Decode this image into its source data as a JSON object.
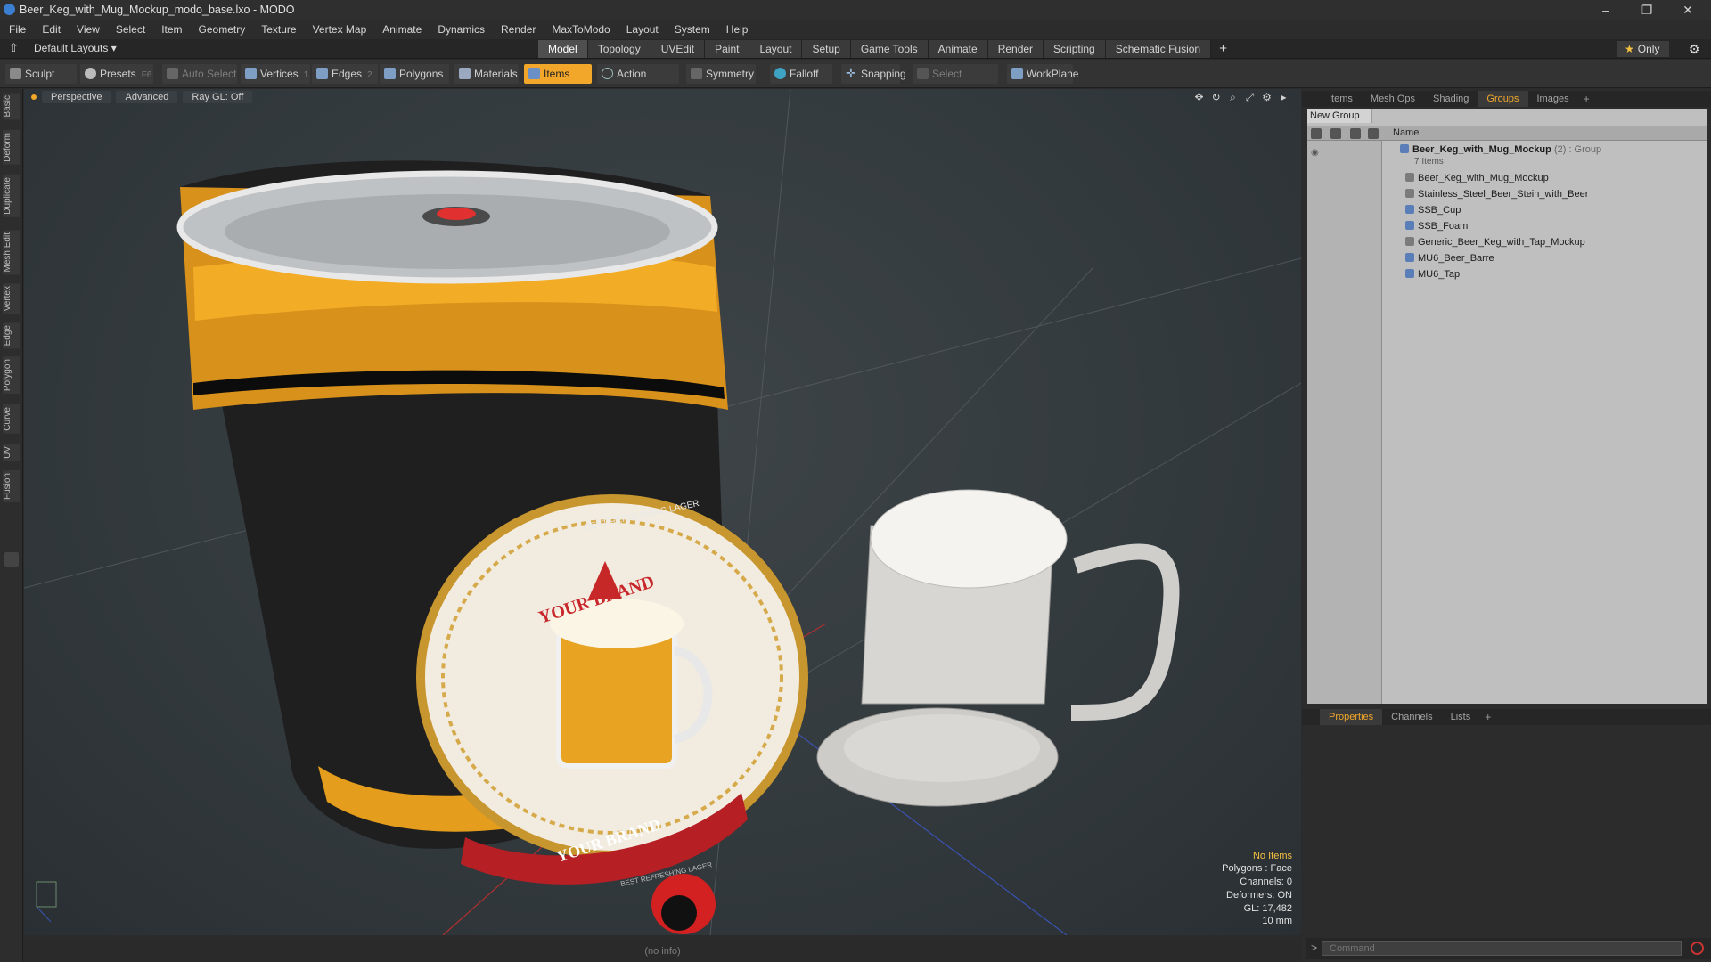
{
  "window": {
    "title": "Beer_Keg_with_Mug_Mockup_modo_base.lxo - MODO",
    "minimize": "–",
    "restore": "❐",
    "close": "✕"
  },
  "menu": [
    "File",
    "Edit",
    "View",
    "Select",
    "Item",
    "Geometry",
    "Texture",
    "Vertex Map",
    "Animate",
    "Dynamics",
    "Render",
    "MaxToModo",
    "Layout",
    "System",
    "Help"
  ],
  "layout": {
    "selector": "Default Layouts ▾",
    "tabs": [
      "Model",
      "Topology",
      "UVEdit",
      "Paint",
      "Layout",
      "Setup",
      "Game Tools",
      "Animate",
      "Render",
      "Scripting",
      "Schematic Fusion"
    ],
    "active_tab": "Model",
    "add": "+",
    "only": "Only"
  },
  "toolbar": {
    "sculpt": "Sculpt",
    "presets": "Presets",
    "presets_key": "F6",
    "auto_select": "Auto Select",
    "vertices": "Vertices",
    "vertices_key": "1",
    "edges": "Edges",
    "edges_key": "2",
    "polygons": "Polygons",
    "materials": "Materials",
    "items": "Items",
    "action_center": "Action Center",
    "symmetry": "Symmetry",
    "falloff": "Falloff",
    "snapping": "Snapping",
    "select_through": "Select Through",
    "workplane": "WorkPlane"
  },
  "left_tabs": [
    "Basic",
    "Deform",
    "Duplicate",
    "Mesh Edit",
    "Vertex",
    "Edge",
    "Polygon",
    "Curve",
    "UV",
    "Fusion"
  ],
  "viewport": {
    "view": "Perspective",
    "shading": "Advanced",
    "raygl": "Ray GL: Off",
    "stats": {
      "selection": "No Items",
      "polygons": "Polygons : Face",
      "channels": "Channels: 0",
      "deformers": "Deformers: ON",
      "gl": "GL: 17,482",
      "grid": "10 mm"
    },
    "label_top": "BEST REFRESHING LAGER",
    "label_brand": "YOUR BRAND",
    "label_ribbon": "YOUR BRAND",
    "label_bottom": "BEST REFRESHING LAGER"
  },
  "status": "(no info)",
  "groups_panel": {
    "tabs": [
      "Items",
      "Mesh Ops",
      "Shading",
      "Groups",
      "Images"
    ],
    "active": "Groups",
    "add": "+",
    "new_group": "New Group",
    "column_name": "Name",
    "root": {
      "name": "Beer_Keg_with_Mug_Mockup",
      "suffix": "(2) : Group",
      "count": "7 Items"
    },
    "children": [
      "Beer_Keg_with_Mug_Mockup",
      "Stainless_Steel_Beer_Stein_with_Beer",
      "SSB_Cup",
      "SSB_Foam",
      "Generic_Beer_Keg_with_Tap_Mockup",
      "MU6_Beer_Barre",
      "MU6_Tap"
    ]
  },
  "props_panel": {
    "tabs": [
      "Properties",
      "Channels",
      "Lists"
    ],
    "active": "Properties",
    "add": "+"
  },
  "command": {
    "placeholder": "Command"
  },
  "colors": {
    "accent": "#f2a72a",
    "keg_band": "#f0a21a",
    "keg_body": "#1f1f1f"
  }
}
